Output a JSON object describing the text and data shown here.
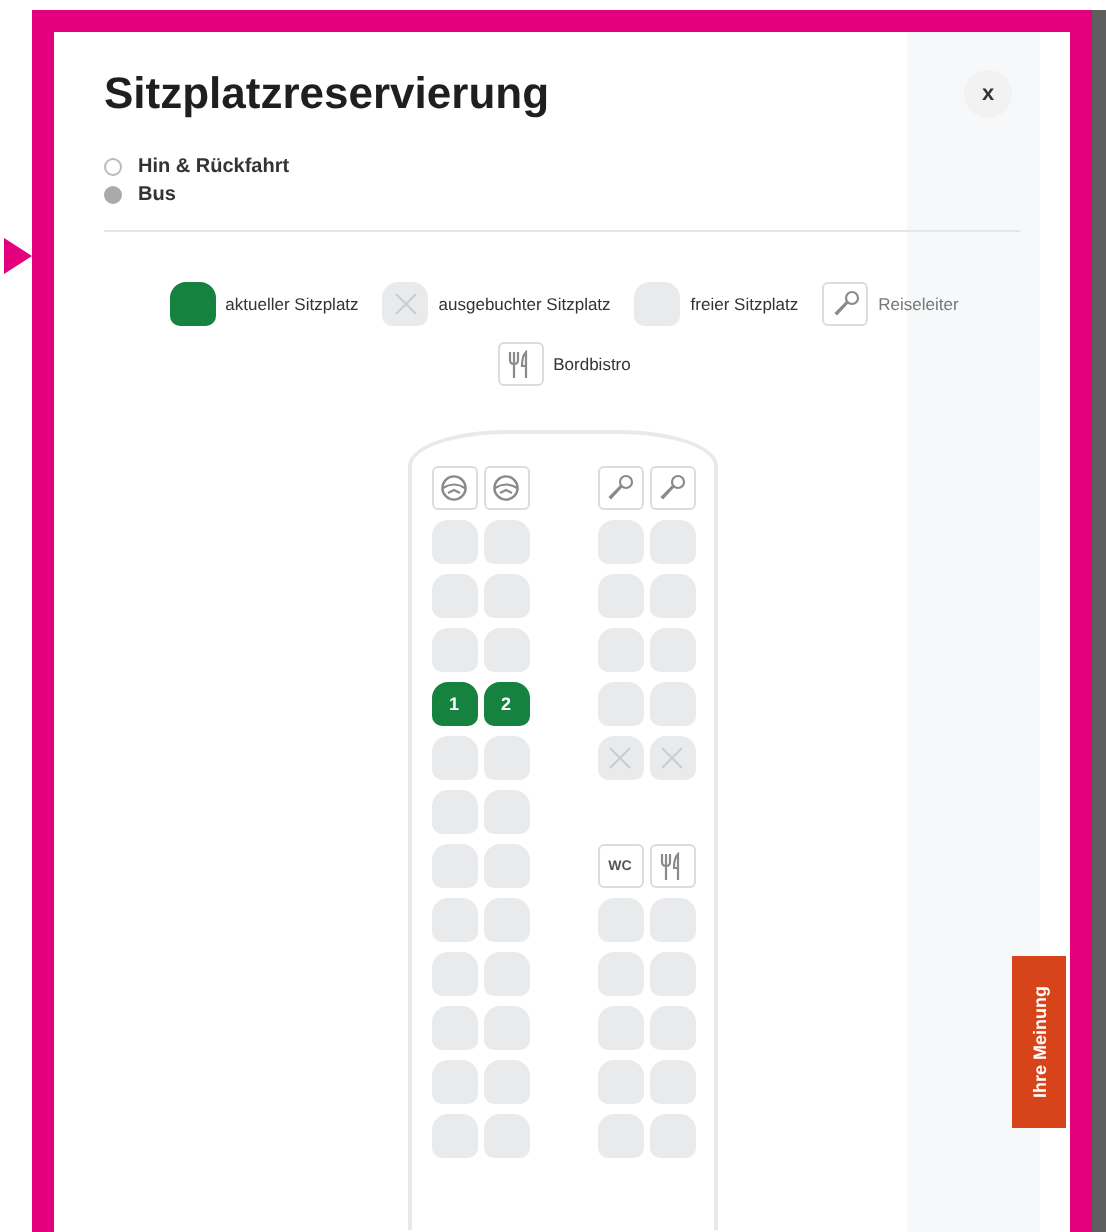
{
  "dialog": {
    "title": "Sitzplatzreservierung",
    "close": "x",
    "route": [
      {
        "label": "Hin & Rückfahrt",
        "selected": false
      },
      {
        "label": "Bus",
        "selected": true
      }
    ]
  },
  "legend": [
    {
      "kind": "current",
      "label": "aktueller Sitzplatz"
    },
    {
      "kind": "booked",
      "label": "ausgebuchter Sitzplatz"
    },
    {
      "kind": "free",
      "label": "freier Sitzplatz"
    },
    {
      "kind": "guide",
      "label": "Reiseleiter"
    },
    {
      "kind": "bistro",
      "label": "Bordbistro"
    }
  ],
  "seatmap": {
    "rows": [
      {
        "left": [
          {
            "kind": "driver"
          },
          {
            "kind": "driver"
          }
        ],
        "right": [
          {
            "kind": "guide"
          },
          {
            "kind": "guide"
          }
        ]
      },
      {
        "left": [
          {
            "kind": "free"
          },
          {
            "kind": "free"
          }
        ],
        "right": [
          {
            "kind": "free"
          },
          {
            "kind": "free"
          }
        ]
      },
      {
        "left": [
          {
            "kind": "free"
          },
          {
            "kind": "free"
          }
        ],
        "right": [
          {
            "kind": "free"
          },
          {
            "kind": "free"
          }
        ]
      },
      {
        "left": [
          {
            "kind": "free"
          },
          {
            "kind": "free"
          }
        ],
        "right": [
          {
            "kind": "free"
          },
          {
            "kind": "free"
          }
        ]
      },
      {
        "left": [
          {
            "kind": "current",
            "label": "1"
          },
          {
            "kind": "current",
            "label": "2"
          }
        ],
        "right": [
          {
            "kind": "free"
          },
          {
            "kind": "free"
          }
        ]
      },
      {
        "left": [
          {
            "kind": "free"
          },
          {
            "kind": "free"
          }
        ],
        "right": [
          {
            "kind": "booked"
          },
          {
            "kind": "booked"
          }
        ]
      },
      {
        "left": [
          {
            "kind": "free"
          },
          {
            "kind": "free"
          }
        ],
        "right": [
          {
            "kind": "empty"
          },
          {
            "kind": "empty"
          }
        ]
      },
      {
        "left": [
          {
            "kind": "free"
          },
          {
            "kind": "free"
          }
        ],
        "right": [
          {
            "kind": "wc",
            "label": "WC"
          },
          {
            "kind": "bistro"
          }
        ]
      },
      {
        "left": [
          {
            "kind": "free"
          },
          {
            "kind": "free"
          }
        ],
        "right": [
          {
            "kind": "free"
          },
          {
            "kind": "free"
          }
        ]
      },
      {
        "left": [
          {
            "kind": "free"
          },
          {
            "kind": "free"
          }
        ],
        "right": [
          {
            "kind": "free"
          },
          {
            "kind": "free"
          }
        ]
      },
      {
        "left": [
          {
            "kind": "free"
          },
          {
            "kind": "free"
          }
        ],
        "right": [
          {
            "kind": "free"
          },
          {
            "kind": "free"
          }
        ]
      },
      {
        "left": [
          {
            "kind": "free"
          },
          {
            "kind": "free"
          }
        ],
        "right": [
          {
            "kind": "free"
          },
          {
            "kind": "free"
          }
        ]
      },
      {
        "left": [
          {
            "kind": "free"
          },
          {
            "kind": "free"
          }
        ],
        "right": [
          {
            "kind": "free"
          },
          {
            "kind": "free"
          }
        ]
      }
    ]
  },
  "feedback_tab": "Ihre Meinung"
}
